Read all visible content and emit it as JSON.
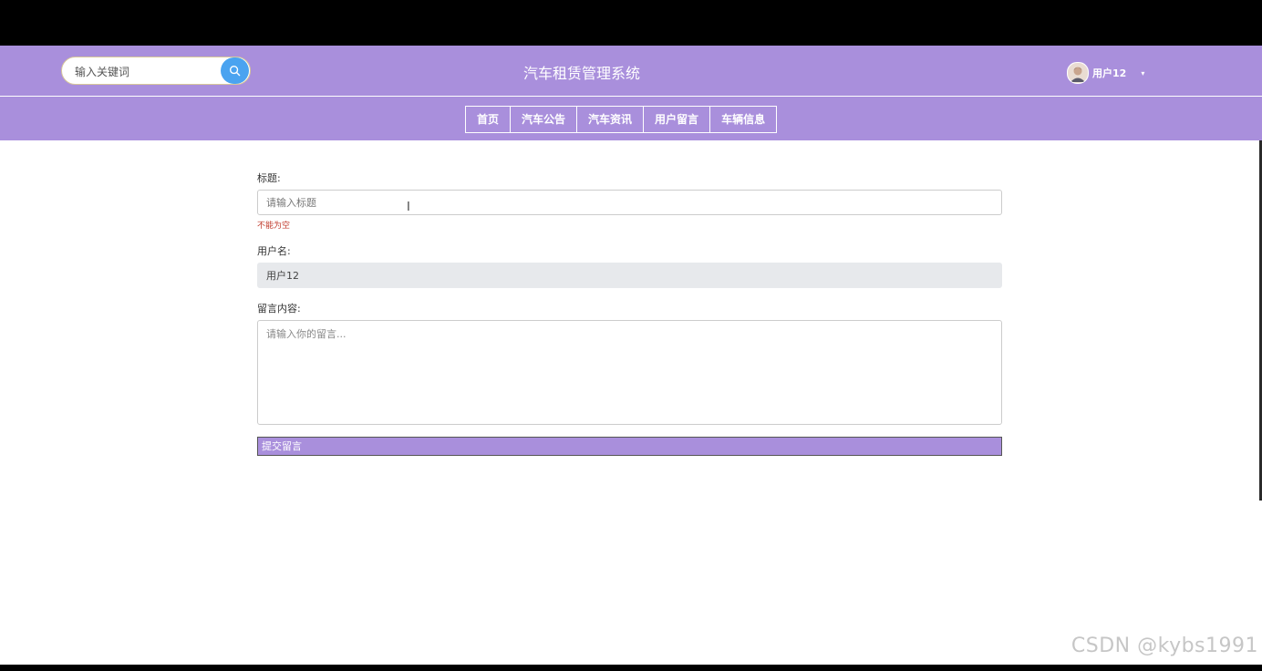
{
  "header": {
    "search_placeholder": "输入关键词",
    "site_title": "汽车租赁管理系统",
    "username": "用户12",
    "caret": "▾"
  },
  "nav": {
    "items": [
      {
        "label": "首页"
      },
      {
        "label": "汽车公告"
      },
      {
        "label": "汽车资讯"
      },
      {
        "label": "用户留言"
      },
      {
        "label": "车辆信息"
      }
    ]
  },
  "form": {
    "title_label": "标题:",
    "title_placeholder": "请输入标题",
    "title_error": "不能为空",
    "username_label": "用户名:",
    "username_value": "用户12",
    "content_label": "留言内容:",
    "content_placeholder": "请输入你的留言...",
    "submit_label": "提交留言"
  },
  "watermark": "CSDN @kybs1991",
  "colors": {
    "theme": "#a98fdc",
    "search_button": "#4aa3f0",
    "error": "#c0392b"
  }
}
